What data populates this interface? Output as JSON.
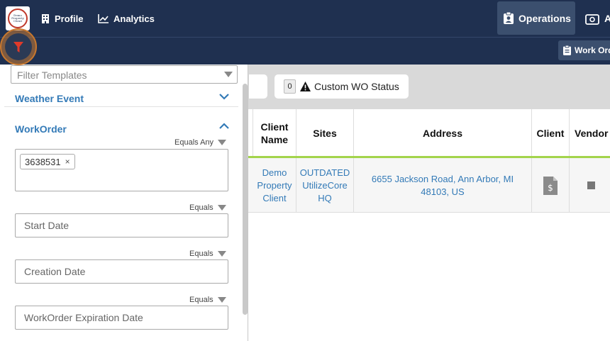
{
  "nav": {
    "logo_text": "Demo Property Client",
    "profile": "Profile",
    "analytics": "Analytics",
    "operations": "Operations",
    "a": "A",
    "work_order": "Work Order"
  },
  "sidebar": {
    "template_placeholder": "Filter Templates",
    "weather_event": "Weather Event",
    "workorder": "WorkOrder",
    "equals_any": "Equals Any",
    "workorder_chip": "3638531",
    "chip_remove": "×",
    "start_date_op": "Equals",
    "start_date_placeholder": "Start Date",
    "creation_date_op": "Equals",
    "creation_date_placeholder": "Creation Date",
    "expiration_op": "Equals",
    "expiration_placeholder": "WorkOrder Expiration Date"
  },
  "toolbar": {
    "status_count": "0",
    "status_label": "Custom WO Status"
  },
  "table": {
    "headers": [
      "Client Name",
      "Sites",
      "Address",
      "Client",
      "Vendor"
    ],
    "row": {
      "client_name": "Demo Property Client",
      "site": "OUTDATED UtilizeCore HQ",
      "address": "6655 Jackson Road, Ann Arbor, MI 48103, US"
    }
  },
  "colors": {
    "nav_bg": "#1f3050",
    "accent": "#337ab7",
    "highlight_ring": "#c8782e",
    "filter_icon": "#e03a2a",
    "row_divider": "#a3d44b"
  },
  "icons": {
    "profile": "building-icon",
    "analytics": "chart-line-icon",
    "operations": "clipboard-user-icon",
    "a": "money-icon",
    "work_order": "clipboard-icon",
    "filter": "filter-icon"
  }
}
